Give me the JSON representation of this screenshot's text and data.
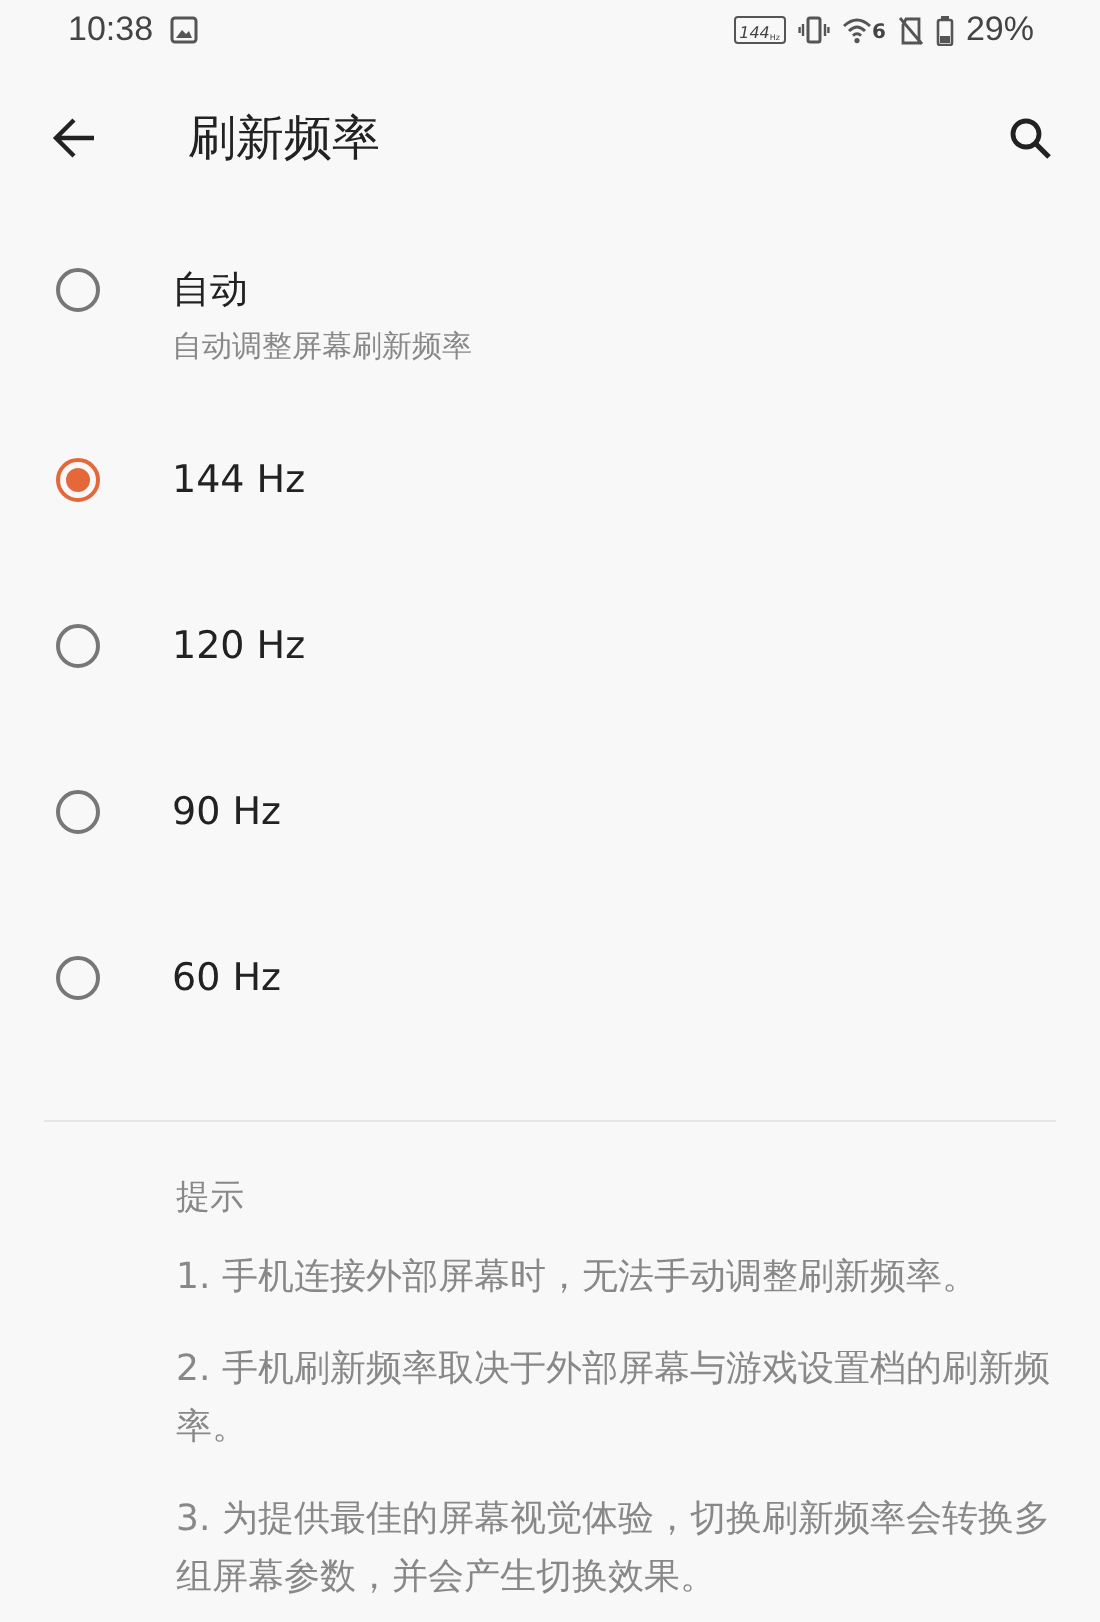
{
  "status_bar": {
    "time": "10:38",
    "refresh_badge": "144",
    "refresh_unit": "Hz",
    "wifi_badge": "6",
    "battery": "29%"
  },
  "toolbar": {
    "title": "刷新频率"
  },
  "options": [
    {
      "label": "自动",
      "subtitle": "自动调整屏幕刷新频率",
      "selected": false
    },
    {
      "label": "144 Hz",
      "selected": true
    },
    {
      "label": "120 Hz",
      "selected": false
    },
    {
      "label": "90 Hz",
      "selected": false
    },
    {
      "label": "60 Hz",
      "selected": false
    }
  ],
  "tips": {
    "heading": "提示",
    "items": [
      "1. 手机连接外部屏幕时，无法手动调整刷新频率。",
      "2. 手机刷新频率取决于外部屏幕与游戏设置档的刷新频率。",
      "3. 为提供最佳的屏幕视觉体验，切换刷新频率会转换多组屏幕参数，并会产生切换效果。"
    ]
  }
}
